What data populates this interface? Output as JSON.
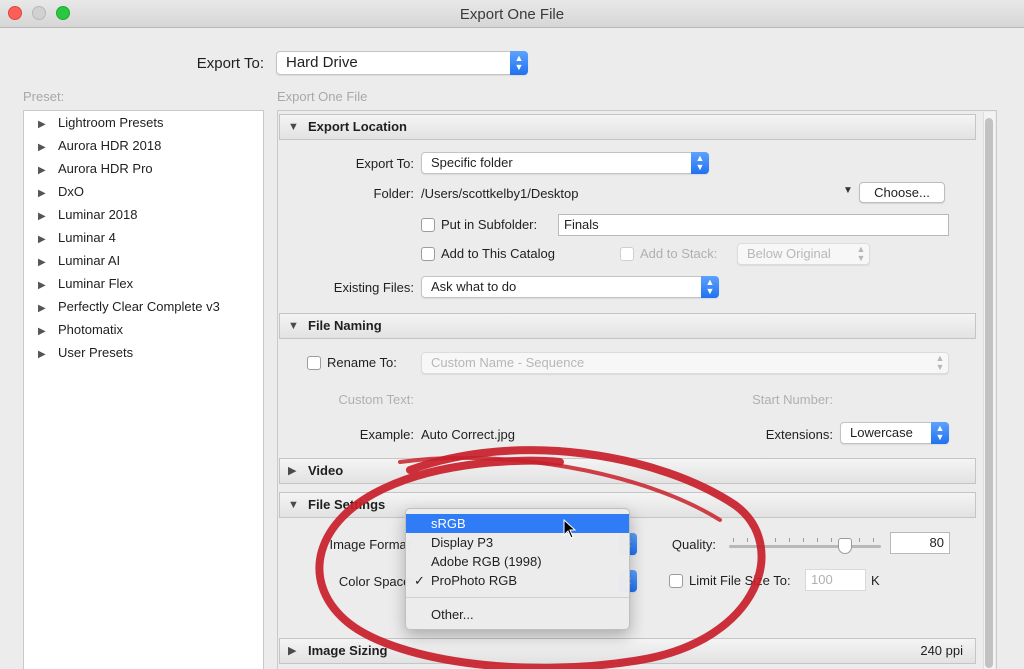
{
  "window": {
    "title": "Export One File"
  },
  "export_to": {
    "label": "Export To:",
    "value": "Hard Drive"
  },
  "preset_label": "Preset:",
  "panel_label": "Export One File",
  "presets": [
    "Lightroom Presets",
    "Aurora HDR 2018",
    "Aurora HDR Pro",
    "DxO",
    "Luminar 2018",
    "Luminar 4",
    "Luminar AI",
    "Luminar Flex",
    "Perfectly Clear Complete v3",
    "Photomatix",
    "User Presets"
  ],
  "export_location": {
    "header": "Export Location",
    "export_to_label": "Export To:",
    "export_to_value": "Specific folder",
    "folder_label": "Folder:",
    "folder_path": "/Users/scottkelby1/Desktop",
    "choose_button": "Choose...",
    "put_in_subfolder": "Put in Subfolder:",
    "subfolder_value": "Finals",
    "add_to_catalog": "Add to This Catalog",
    "add_to_stack": "Add to Stack:",
    "stack_value": "Below Original",
    "existing_files_label": "Existing Files:",
    "existing_files_value": "Ask what to do"
  },
  "file_naming": {
    "header": "File Naming",
    "rename_to": "Rename To:",
    "rename_value": "Custom Name - Sequence",
    "custom_text_label": "Custom Text:",
    "start_number_label": "Start Number:",
    "example_label": "Example:",
    "example_value": "Auto Correct.jpg",
    "extensions_label": "Extensions:",
    "extensions_value": "Lowercase"
  },
  "video": {
    "header": "Video"
  },
  "file_settings": {
    "header": "File Settings",
    "image_format_label": "Image Format:",
    "color_space_label": "Color Space:",
    "quality_label": "Quality:",
    "quality_value": "80",
    "quality_level_percent": 80,
    "limit_file_size": "Limit File Size To:",
    "limit_value": "100",
    "limit_unit": "K"
  },
  "color_space_menu": {
    "items": [
      {
        "label": "sRGB",
        "highlighted": true,
        "checked": false
      },
      {
        "label": "Display P3",
        "highlighted": false,
        "checked": false
      },
      {
        "label": "Adobe RGB (1998)",
        "highlighted": false,
        "checked": false
      },
      {
        "label": "ProPhoto RGB",
        "highlighted": false,
        "checked": true
      }
    ],
    "other": "Other...",
    "check_glyph": "✓"
  },
  "image_sizing": {
    "header": "Image Sizing",
    "resolution": "240 ppi"
  },
  "colors": {
    "accent": "#2f7cf6",
    "annotation_red": "#c8202a"
  }
}
